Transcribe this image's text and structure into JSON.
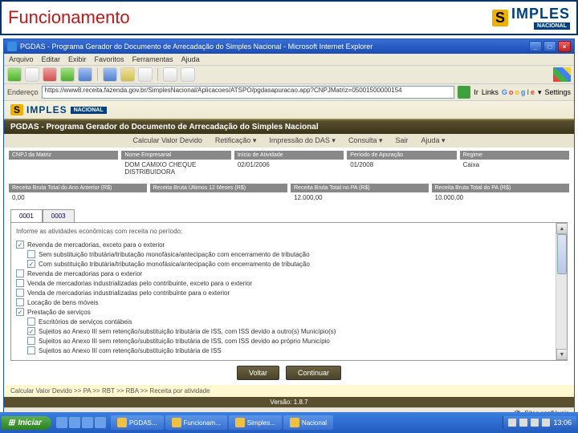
{
  "slide": {
    "title": "Funcionamento"
  },
  "brand": {
    "s": "S",
    "name": "IMPLES",
    "sub": "NACIONAL"
  },
  "ie": {
    "title": "PGDAS - Programa Gerador do Documento de Arrecadação do Simples Nacional - Microsoft Internet Explorer",
    "menus": [
      "Arquivo",
      "Editar",
      "Exibir",
      "Favoritos",
      "Ferramentas",
      "Ajuda"
    ],
    "addr_label": "Endereço",
    "addr_value": "https://www8.receita.fazenda.gov.br/SimplesNacional/Aplicacoes/ATSPO/pgdasapuracao.app?CNPJMatriz=05001500000154",
    "go": "Ir",
    "links": "Links",
    "google": "Google",
    "settings": "Settings"
  },
  "pgdas": {
    "title": "PGDAS - Programa Gerador do Documento de Arrecadação do Simples Nacional",
    "menu": [
      "Calcular Valor Devido",
      "Retificação ▾",
      "Impressão do DAS ▾",
      "Consulta ▾",
      "Sair",
      "Ajuda ▾"
    ]
  },
  "info1": [
    {
      "label": "CNPJ da Matriz",
      "value": ""
    },
    {
      "label": "Nome Empresarial",
      "value": "DOM CAMIXO CHEQUE DISTRIBUIDORA"
    },
    {
      "label": "Início de Atividade",
      "value": "02/01/2006"
    },
    {
      "label": "Período de Apuração",
      "value": "01/2008"
    },
    {
      "label": "Regime",
      "value": "Caixa"
    }
  ],
  "info2": [
    {
      "label": "Receita Bruta Total do Ano Anterior (R$)",
      "value": "0,00"
    },
    {
      "label": "Receita Bruta Últimos 12 Meses (R$)",
      "value": ""
    },
    {
      "label": "Receita Bruta Total no PA (R$)",
      "value": "12.000,00"
    },
    {
      "label": "Receita Bruta Total do PA (R$)",
      "value": "10.000,00"
    }
  ],
  "tabs": [
    "0001",
    "0003"
  ],
  "panel_title": "Informe as atividades econômicas com receita no período:",
  "checks": [
    {
      "checked": true,
      "indent": 0,
      "text": "Revenda de mercadorias, exceto para o exterior"
    },
    {
      "checked": false,
      "indent": 1,
      "text": "Sem substituição tributária/tributação monofásica/antecipação com encerramento de tributação"
    },
    {
      "checked": true,
      "indent": 1,
      "text": "Com substituição tributária/tributação monofásica/antecipação com encerramento de tributação"
    },
    {
      "checked": false,
      "indent": 0,
      "text": "Revenda de mercadorias para o exterior"
    },
    {
      "checked": false,
      "indent": 0,
      "text": "Venda de mercadorias industrializadas pelo contribuinte, exceto para o exterior"
    },
    {
      "checked": false,
      "indent": 0,
      "text": "Venda de mercadorias industrializadas pelo contribuinte para o exterior"
    },
    {
      "checked": false,
      "indent": 0,
      "text": "Locação de bens móveis"
    },
    {
      "checked": true,
      "indent": 0,
      "text": "Prestação de serviços"
    },
    {
      "checked": false,
      "indent": 1,
      "text": "Escritórios de serviços contábeis"
    },
    {
      "checked": true,
      "indent": 1,
      "text": "Sujeitos ao Anexo III sem retenção/substituição tributária de ISS, com ISS devido a outro(s) Município(s)"
    },
    {
      "checked": false,
      "indent": 1,
      "text": "Sujeitos ao Anexo III sem retenção/substituição tributária de ISS, com ISS devido ao próprio Município"
    },
    {
      "checked": false,
      "indent": 1,
      "text": "Sujeitos ao Anexo III com retenção/substituição tributária de ISS"
    }
  ],
  "actions": {
    "back": "Voltar",
    "continue": "Continuar"
  },
  "hint": "Calcular Valor Devido >> PA >> RBT >> RBA >> Receita por atividade",
  "version": "Versão: 1.8.7",
  "status": "Sites confiáveis",
  "taskbar": {
    "start": "Iniciar",
    "items": [
      "PGDAS...",
      "Funcionam...",
      "Simples...",
      "Nacional"
    ],
    "clock": "13:06"
  }
}
